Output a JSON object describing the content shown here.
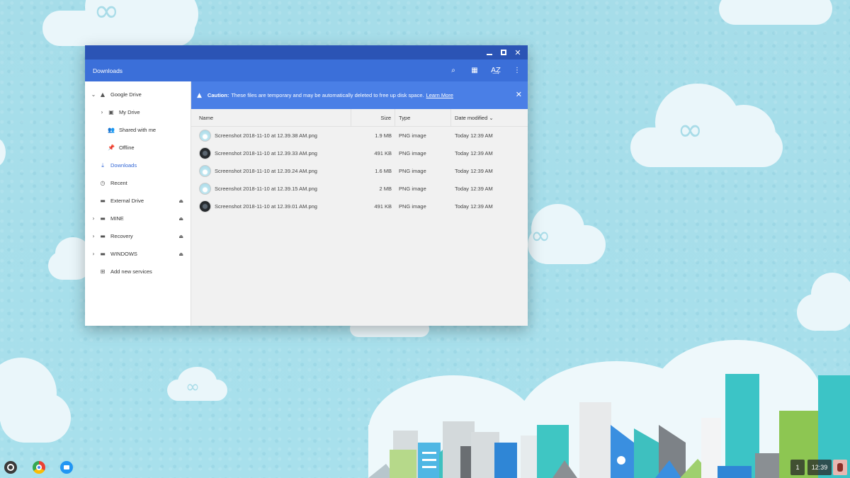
{
  "window": {
    "title": "Downloads",
    "controls": {
      "minimize": "",
      "maximize": "",
      "close": "✕"
    },
    "toolbar": {
      "search": "⌕",
      "grid": "▦",
      "sort": "A͢Z",
      "more": "⋮"
    }
  },
  "sidebar": {
    "items": [
      {
        "label": "Google Drive",
        "icon": "▲",
        "chevron": "⌄",
        "eject": ""
      },
      {
        "label": "My Drive",
        "icon": "▣",
        "chevron": "›",
        "eject": ""
      },
      {
        "label": "Shared with me",
        "icon": "👥",
        "chevron": "",
        "eject": ""
      },
      {
        "label": "Offline",
        "icon": "📌",
        "chevron": "",
        "eject": ""
      },
      {
        "label": "Downloads",
        "icon": "⤓",
        "chevron": "",
        "eject": ""
      },
      {
        "label": "Recent",
        "icon": "◷",
        "chevron": "",
        "eject": ""
      },
      {
        "label": "External Drive",
        "icon": "▬",
        "chevron": "",
        "eject": "⏏"
      },
      {
        "label": "MINE",
        "icon": "▬",
        "chevron": "›",
        "eject": "⏏"
      },
      {
        "label": "Recovery",
        "icon": "▬",
        "chevron": "›",
        "eject": "⏏"
      },
      {
        "label": "WINDOWS",
        "icon": "▬",
        "chevron": "›",
        "eject": "⏏"
      },
      {
        "label": "Add new services",
        "icon": "⊞",
        "chevron": "",
        "eject": ""
      }
    ]
  },
  "banner": {
    "icon": "▲",
    "label": "Caution:",
    "text": "These files are temporary and may be automatically deleted to free up disk space.",
    "link": "Learn More",
    "close": "✕"
  },
  "table": {
    "headers": {
      "name": "Name",
      "size": "Size",
      "type": "Type",
      "date": "Date modified ⌄"
    },
    "rows": [
      {
        "name": "Screenshot 2018-11-10 at 12.39.38 AM.png",
        "size": "1.9 MB",
        "type": "PNG image",
        "date": "Today 12:39 AM",
        "thumb": "light"
      },
      {
        "name": "Screenshot 2018-11-10 at 12.39.33 AM.png",
        "size": "491 KB",
        "type": "PNG image",
        "date": "Today 12:39 AM",
        "thumb": "dark"
      },
      {
        "name": "Screenshot 2018-11-10 at 12.39.24 AM.png",
        "size": "1.6 MB",
        "type": "PNG image",
        "date": "Today 12:39 AM",
        "thumb": "light"
      },
      {
        "name": "Screenshot 2018-11-10 at 12.39.15 AM.png",
        "size": "2 MB",
        "type": "PNG image",
        "date": "Today 12:39 AM",
        "thumb": "light"
      },
      {
        "name": "Screenshot 2018-11-10 at 12.39.01 AM.png",
        "size": "491 KB",
        "type": "PNG image",
        "date": "Today 12:39 AM",
        "thumb": "dark"
      }
    ]
  },
  "shelf": {
    "launcher": "launcher-icon",
    "apps": [
      "chrome-icon",
      "files-icon"
    ],
    "tray": {
      "notifications": "1",
      "time": "12:39"
    }
  },
  "colors": {
    "titlebar": "#2b54b5",
    "appbar": "#3b6fd9",
    "banner": "#4a7fe6",
    "accent": "#3367d6",
    "wallpaper": "#a8dfeb"
  }
}
